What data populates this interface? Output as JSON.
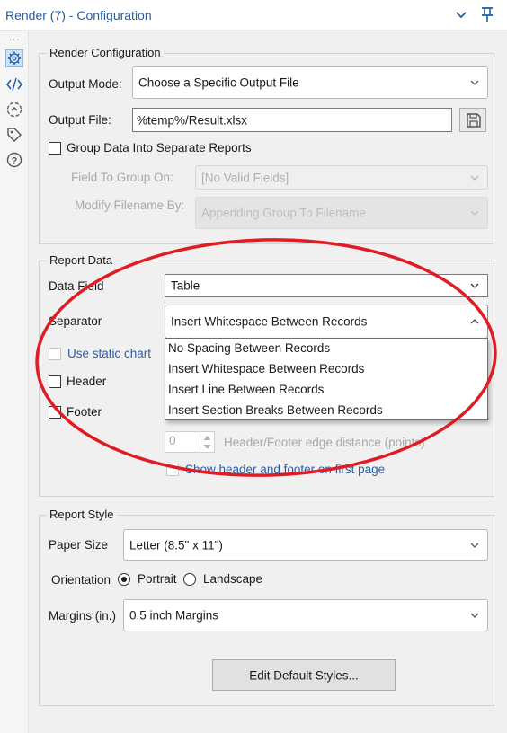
{
  "titlebar": {
    "title": "Render (7) - Configuration",
    "chevron_icon": "chevron-down-icon",
    "pin_icon": "pin-icon"
  },
  "rail": {
    "icons": [
      "gear-icon",
      "code-icon",
      "navigate-icon",
      "tag-icon",
      "help-icon"
    ],
    "active": "gear-icon",
    "dots": "..."
  },
  "render_config": {
    "title": "Render Configuration",
    "output_mode_label": "Output Mode:",
    "output_mode_value": "Choose a Specific Output File",
    "output_file_label": "Output File:",
    "output_file_value": "%temp%/Result.xlsx",
    "group_data_label": "Group Data Into Separate Reports",
    "field_group_label": "Field To Group On:",
    "field_group_value": "[No Valid Fields]",
    "modify_filename_label": "Modify Filename By:",
    "modify_filename_value": "Appending Group To Filename"
  },
  "report_data": {
    "title": "Report Data",
    "data_field_label": "Data Field",
    "data_field_value": "Table",
    "separator_label": "Separator",
    "separator_value": "Insert Whitespace Between Records",
    "use_static_chart_label": "Use static chart",
    "header_label": "Header",
    "footer_label": "Footer",
    "edge_distance_value": "0",
    "edge_distance_label": "Header/Footer edge distance (points)",
    "show_first_page_label": "Show header and footer on first page",
    "separator_options": [
      "No Spacing Between Records",
      "Insert Whitespace Between Records",
      "Insert Line Between Records",
      "Insert Section Breaks Between Records"
    ]
  },
  "report_style": {
    "title": "Report Style",
    "paper_size_label": "Paper Size",
    "paper_size_value": "Letter (8.5\" x 11\")",
    "orientation_label": "Orientation",
    "portrait_label": "Portrait",
    "landscape_label": "Landscape",
    "orientation_selected": "Portrait",
    "margins_label": "Margins (in.)",
    "margins_value": "0.5 inch Margins",
    "edit_styles_label": "Edit Default Styles..."
  },
  "colors": {
    "title_blue": "#1f5fa8",
    "annotation_red": "#e01b22",
    "panel_bg": "#f0f0f0"
  }
}
